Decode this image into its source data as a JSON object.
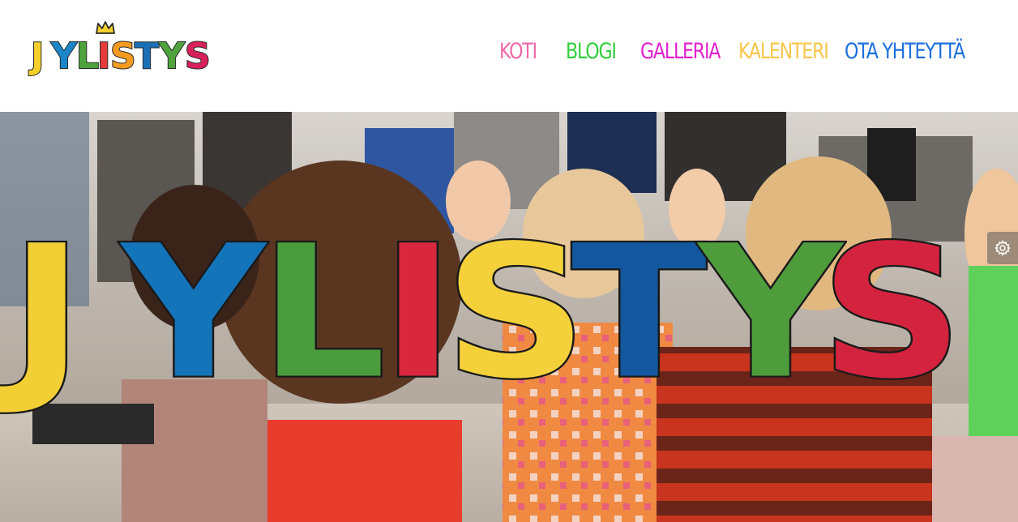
{
  "brand": {
    "logo_text": "JYLISTYS",
    "logo_letters": [
      "J",
      "Y",
      "L",
      "I",
      "S",
      "T",
      "Y",
      "S"
    ],
    "letter_colors": [
      "#f4cf2c",
      "#1a86c9",
      "#e63c3c",
      "#ea3a7a",
      "#f39a20",
      "#1b6fb5",
      "#4ea33d",
      "#d9205a"
    ]
  },
  "nav": {
    "items": [
      {
        "label": "KOTI",
        "color": "#f06aa8"
      },
      {
        "label": "BLOGI",
        "color": "#2fcf3a"
      },
      {
        "label": "GALLERIA",
        "color": "#e020d0"
      },
      {
        "label": "KALENTERI",
        "color": "#f8c64a"
      },
      {
        "label": "OTA YHTEYTTÄ",
        "color": "#1a6fe0"
      }
    ]
  },
  "hero": {
    "title": "JYLISTYS",
    "letters": [
      "J",
      "Y",
      "L",
      "I",
      "S",
      "T",
      "Y",
      "S"
    ],
    "letter_colors": [
      "#f2cf35",
      "#1474b9",
      "#4a9d3d",
      "#d9283e",
      "#f4d13a",
      "#13589e",
      "#4f9c3d",
      "#d4233e"
    ]
  },
  "widgets": {
    "settings_icon": "gear-icon"
  }
}
